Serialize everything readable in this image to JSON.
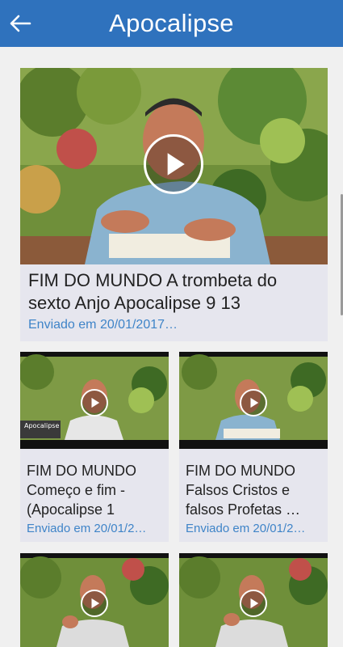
{
  "header": {
    "title": "Apocalipse",
    "back_icon": "arrow-left-icon",
    "background": "#2f72bd"
  },
  "videos": [
    {
      "title": "FIM DO MUNDO   A trombeta do sexto Anjo   Apocalipse 9 13",
      "date": "Enviado em 20/01/2017…"
    },
    {
      "title": "FIM DO MUNDO Começo e fim - (Apocalipse 1",
      "date": "Enviado em 20/01/2…",
      "thumb_caption": "Apocalipse"
    },
    {
      "title": "FIM DO MUNDO Falsos Cristos e falsos Profetas   …",
      "date": "Enviado em 20/01/2…"
    },
    {
      "title": "",
      "date": ""
    },
    {
      "title": "",
      "date": ""
    }
  ],
  "icons": {
    "play": "play-icon"
  },
  "colors": {
    "accent": "#2f72bd",
    "date_text": "#3f84c8",
    "card_background": "#e6e6ee"
  }
}
